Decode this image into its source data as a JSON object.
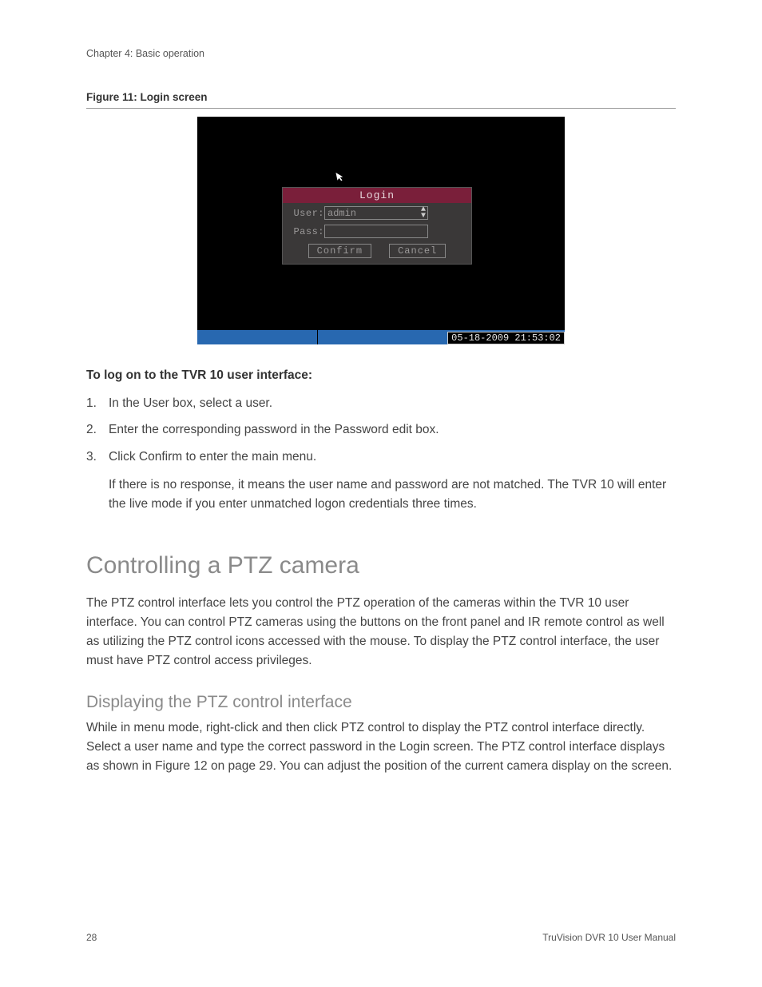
{
  "header": {
    "chapter": "Chapter 4: Basic operation"
  },
  "figure": {
    "caption": "Figure 11: Login screen"
  },
  "login_screen": {
    "title": "Login",
    "user_label": "User:",
    "user_value": "admin",
    "pass_label": "Pass:",
    "pass_value": "",
    "confirm": "Confirm",
    "cancel": "Cancel",
    "timestamp": "05-18-2009 21:53:02"
  },
  "instructions": {
    "lead": "To log on to the TVR 10 user interface:",
    "steps": [
      "In the User box, select a user.",
      "Enter the corresponding password in the Password edit box.",
      "Click Confirm to enter the main menu."
    ],
    "note": "If there is no response, it means the user name and password are not matched. The TVR 10 will enter the live mode if you enter unmatched logon credentials three times."
  },
  "section": {
    "heading": "Controlling a PTZ camera",
    "body": "The PTZ control interface lets you control the PTZ operation of the cameras within the TVR 10 user interface. You can control PTZ cameras using the buttons on the front panel and IR remote control as well as utilizing the PTZ control icons accessed with the mouse. To display the PTZ control interface, the user must have PTZ control access privileges."
  },
  "subsection": {
    "heading": "Displaying the PTZ control interface",
    "body": "While in menu mode, right-click and then click PTZ control to display the PTZ control interface directly. Select a user name and type the correct password in the Login screen. The PTZ control interface displays as shown in Figure 12 on page 29. You can adjust the position of the current camera display on the screen."
  },
  "footer": {
    "page": "28",
    "manual": "TruVision DVR 10 User Manual"
  }
}
